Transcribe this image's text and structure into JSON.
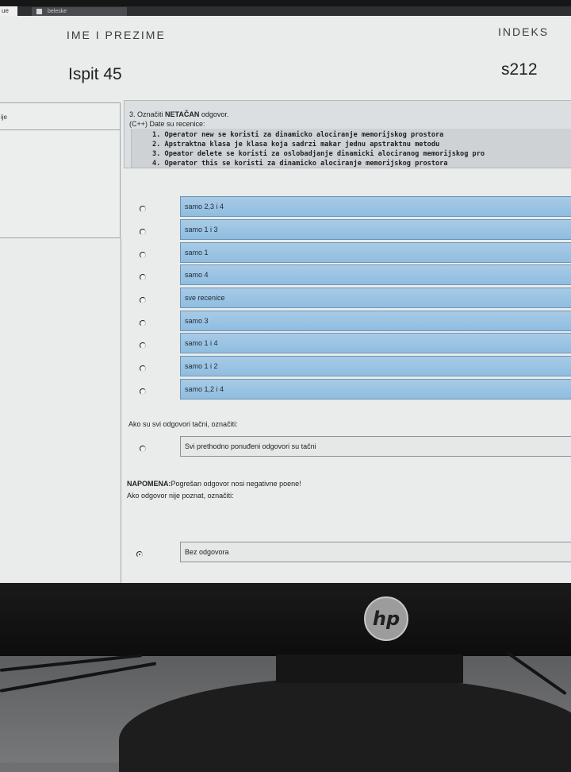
{
  "browser": {
    "active_tab": "ue",
    "tab_title": "beleske"
  },
  "header": {
    "name_label": "IME I PREZIME",
    "index_label": "INDEKS",
    "exam_title": "Ispit 45",
    "index_value": "s212"
  },
  "side_panel": {
    "label": "ije"
  },
  "question": {
    "number_prefix": "3. Označiti ",
    "emphasis": "NETAČAN",
    "suffix": " odgovor.",
    "subtitle": "(C++) Date su recenice:",
    "statements": [
      "1. Operator new se koristi za dinamicko alociranje memorijskog prostora",
      "2. Apstraktna klasa je klasa koja sadrzi makar jednu apstraktnu metodu",
      "3. Opeator delete se koristi za oslobadjanje dinamicki alociranog memorijskog pro",
      "4. Operator this se koristi za dinamicko alociranje memorijskog prostora"
    ]
  },
  "answers": [
    "samo 2,3 i 4",
    "samo 1 i 3",
    "samo 1",
    "samo 4",
    "sve recenice",
    "samo 3",
    "samo 1 i 4",
    "samo 1 i 2",
    "samo 1,2 i 4"
  ],
  "all_correct": {
    "prompt": "Ako su svi odgovori tačni, označiti:",
    "option": "Svi prethodno ponuđeni odgovori su tačni"
  },
  "note": {
    "label": "NAPOMENA:",
    "text": "Pogrešan odgovor nosi negativne poene!",
    "unknown_prompt": "Ako odgovor nije poznat, označiti:",
    "no_answer_option": "Bez odgovora",
    "no_answer_selected": true
  },
  "monitor": {
    "brand": "hp"
  },
  "colors": {
    "option_fill": "#9fc6e4",
    "option_border": "#6e93b6",
    "page_bg": "#e9ecea"
  }
}
